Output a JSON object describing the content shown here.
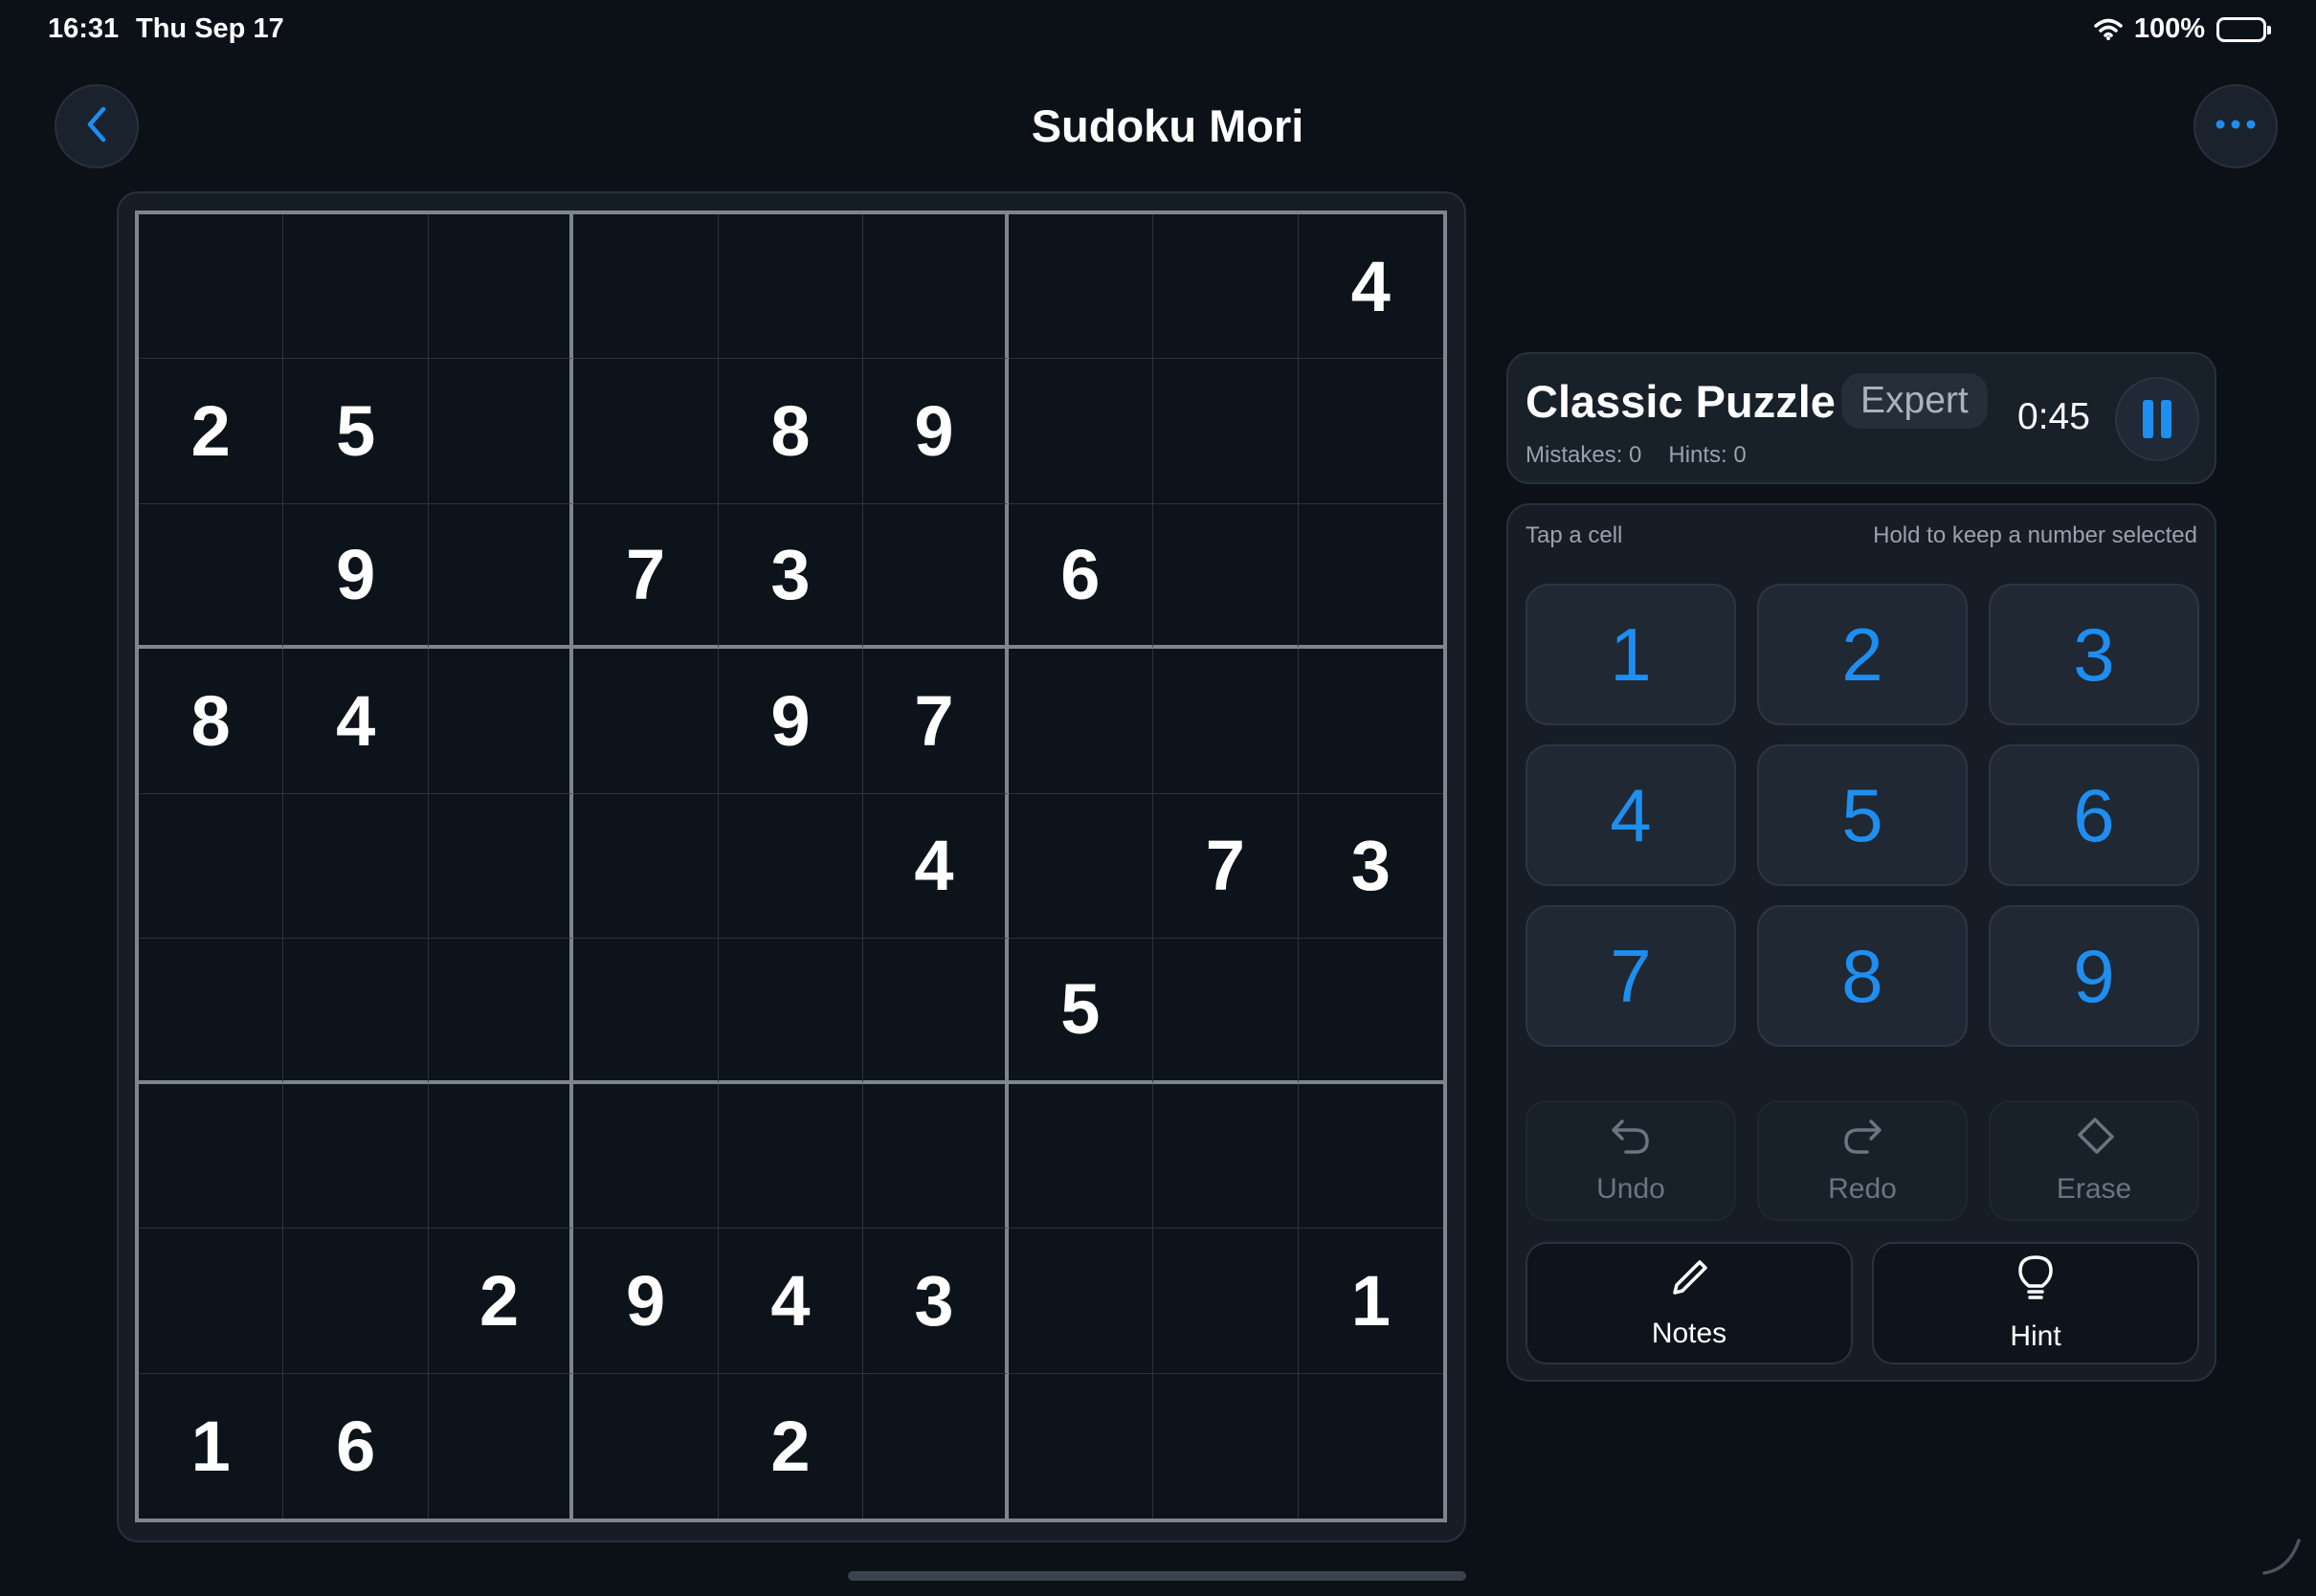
{
  "status": {
    "time": "16:31",
    "date": "Thu Sep 17",
    "battery": "100%"
  },
  "nav": {
    "title": "Sudoku Mori",
    "back_icon": "chevron-left-icon",
    "more_icon": "ellipsis-icon"
  },
  "board": {
    "grid": [
      [
        "",
        "",
        "",
        "",
        "",
        "",
        "",
        "",
        "4"
      ],
      [
        "2",
        "5",
        "",
        "",
        "8",
        "9",
        "",
        "",
        ""
      ],
      [
        "",
        "9",
        "",
        "7",
        "3",
        "",
        "6",
        "",
        ""
      ],
      [
        "8",
        "4",
        "",
        "",
        "9",
        "7",
        "",
        "",
        ""
      ],
      [
        "",
        "",
        "",
        "",
        "",
        "4",
        "",
        "7",
        "3"
      ],
      [
        "",
        "",
        "",
        "",
        "",
        "",
        "5",
        "",
        ""
      ],
      [
        "",
        "",
        "",
        "",
        "",
        "",
        "",
        "",
        ""
      ],
      [
        "",
        "",
        "2",
        "9",
        "4",
        "3",
        "",
        "",
        "1"
      ],
      [
        "1",
        "6",
        "",
        "",
        "2",
        "",
        "",
        "",
        ""
      ]
    ]
  },
  "info": {
    "title": "Classic Puzzle",
    "difficulty": "Expert",
    "mistakes": "Mistakes: 0",
    "hints": "Hints: 0",
    "timer": "0:45"
  },
  "pad": {
    "tip_left": "Tap a cell",
    "tip_right": "Hold to keep a number selected",
    "numbers": [
      "1",
      "2",
      "3",
      "4",
      "5",
      "6",
      "7",
      "8",
      "9"
    ],
    "undo": "Undo",
    "redo": "Redo",
    "erase": "Erase",
    "notes": "Notes",
    "hint": "Hint"
  },
  "colors": {
    "accent": "#1e8ef0",
    "background": "#0c1118"
  }
}
